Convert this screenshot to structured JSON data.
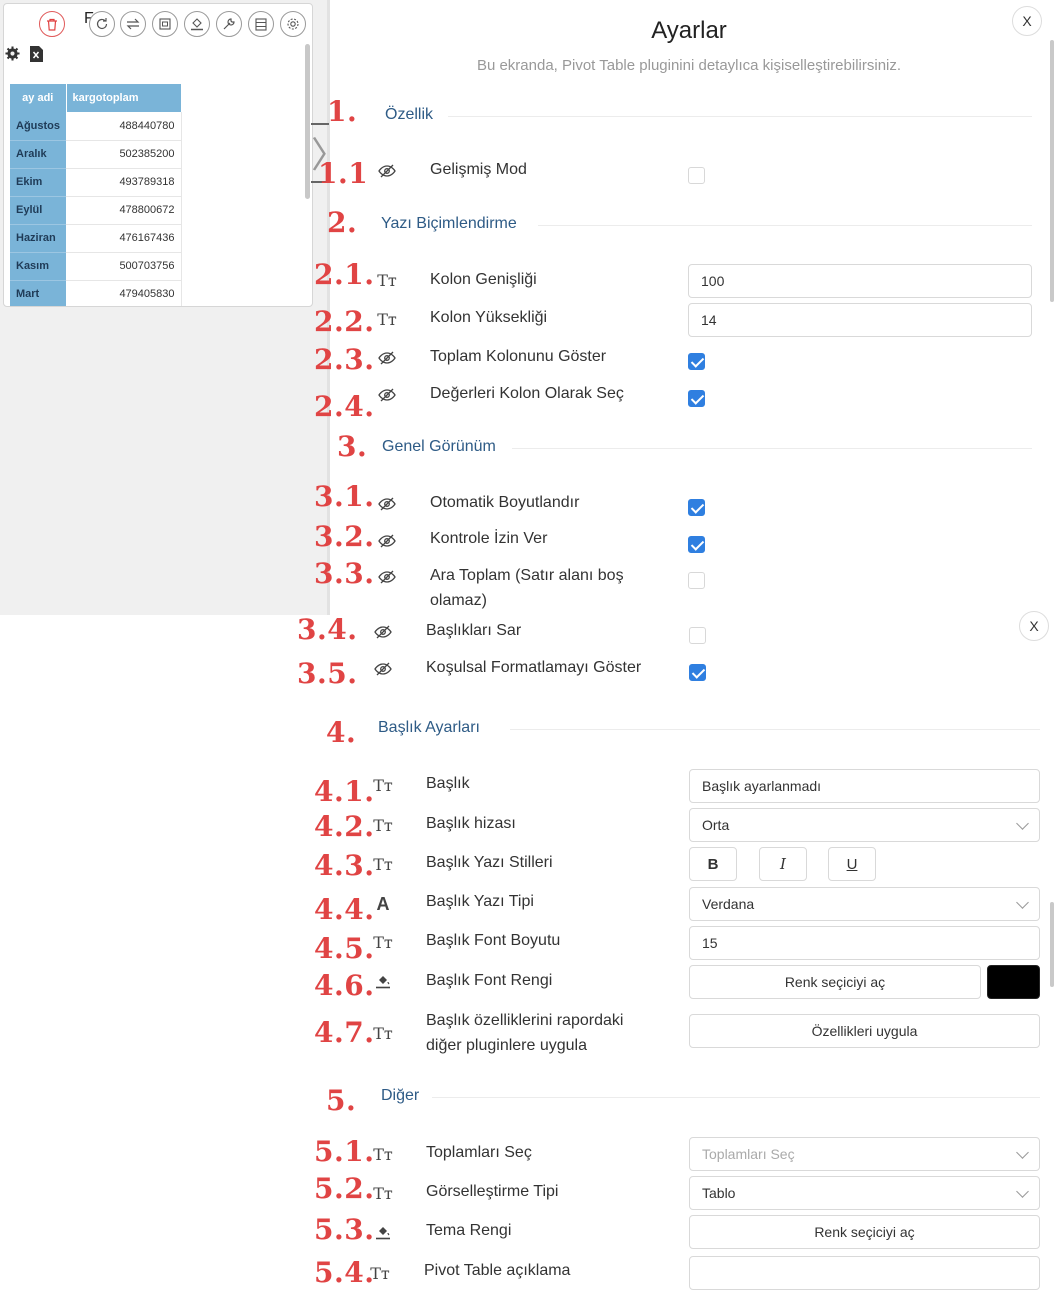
{
  "widget": {
    "title": "F  y  ",
    "table": {
      "headers": [
        "ay adi",
        "kargotoplam"
      ],
      "rows": [
        [
          "Ağustos",
          "488440780"
        ],
        [
          "Aralık",
          "502385200"
        ],
        [
          "Ekim",
          "493789318"
        ],
        [
          "Eylül",
          "478800672"
        ],
        [
          "Haziran",
          "476167436"
        ],
        [
          "Kasım",
          "500703756"
        ],
        [
          "Mart",
          "479405830"
        ]
      ]
    }
  },
  "panel": {
    "title": "Ayarlar",
    "subtitle": "Bu ekranda, Pivot Table pluginini detaylıca kişiselleştirebilirsiniz.",
    "close_label": "X"
  },
  "numbers": {
    "n1": "1.",
    "n1_1": "1.1",
    "n2": "2.",
    "n2_1": "2.1.",
    "n2_2": "2.2.",
    "n2_3": "2.3.",
    "n2_4": "2.4.",
    "n3": "3.",
    "n3_1": "3.1.",
    "n3_2": "3.2.",
    "n3_3": "3.3.",
    "n3_4": "3.4.",
    "n3_5": "3.5.",
    "n4": "4.",
    "n4_1": "4.1.",
    "n4_2": "4.2.",
    "n4_3": "4.3.",
    "n4_4": "4.4.",
    "n4_5": "4.5.",
    "n4_6": "4.6.",
    "n4_7": "4.7.",
    "n5": "5.",
    "n5_1": "5.1.",
    "n5_2": "5.2.",
    "n5_3": "5.3.",
    "n5_4": "5.4."
  },
  "sections": {
    "ozellik": "Özellik",
    "yazi": "Yazı Biçimlendirme",
    "genel": "Genel Görünüm",
    "baslik": "Başlık Ayarları",
    "diger": "Diğer"
  },
  "settings": {
    "gelismis_mod": {
      "label": "Gelişmiş Mod",
      "checked": false
    },
    "kolon_genisligi": {
      "label": "Kolon Genişliği",
      "value": "100"
    },
    "kolon_yuksekligi": {
      "label": "Kolon Yüksekliği",
      "value": "14"
    },
    "toplam_kolonu": {
      "label": "Toplam Kolonunu Göster",
      "checked": true
    },
    "degerleri_kolon": {
      "label": "Değerleri Kolon Olarak Seç",
      "checked": true
    },
    "otomatik_boyut": {
      "label": "Otomatik Boyutlandır",
      "checked": true
    },
    "kontrole_izin": {
      "label": "Kontrole İzin Ver",
      "checked": true
    },
    "ara_toplam": {
      "label_line1": "Ara Toplam (Satır alanı boş",
      "label_line2": "olamaz)",
      "checked": false
    },
    "basliklari_sar": {
      "label": "Başlıkları Sar",
      "checked": false
    },
    "kosulsal": {
      "label": "Koşulsal Formatlamayı Göster",
      "checked": true
    },
    "baslik": {
      "label": "Başlık",
      "value": "Başlık ayarlanmadı"
    },
    "baslik_hizasi": {
      "label": "Başlık hizası",
      "value": "Orta"
    },
    "baslik_stilleri": {
      "label": "Başlık Yazı Stilleri",
      "bold": "B",
      "italic": "I",
      "underline": "U"
    },
    "baslik_yazi_tipi": {
      "label": "Başlık Yazı Tipi",
      "value": "Verdana"
    },
    "baslik_font_boyutu": {
      "label": "Başlık Font Boyutu",
      "value": "15"
    },
    "baslik_font_rengi": {
      "label": "Başlık Font Rengi",
      "button": "Renk seçiciyi aç",
      "color": "#000000"
    },
    "baslik_uygula": {
      "label_line1": "Başlık özelliklerini rapordaki",
      "label_line2": "diğer pluginlere uygula",
      "button": "Özellikleri uygula"
    },
    "toplamlari_sec": {
      "label": "Toplamları Seç",
      "placeholder": "Toplamları Seç"
    },
    "gorsellestirme": {
      "label": "Görselleştirme Tipi",
      "value": "Tablo"
    },
    "tema_rengi": {
      "label": "Tema Rengi",
      "button": "Renk seçiciyi aç"
    },
    "aciklama": {
      "label": "Pivot Table açıklama",
      "value": ""
    }
  },
  "icons": {
    "text": "Tт",
    "font": "A"
  }
}
